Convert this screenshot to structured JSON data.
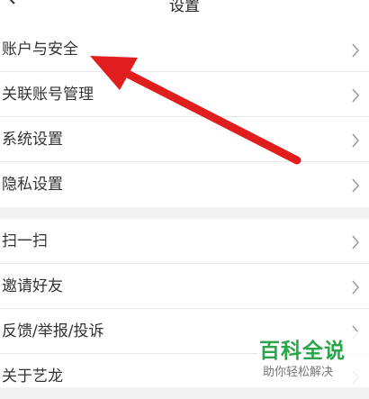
{
  "header": {
    "title": "设置",
    "back_icon": "chevron-left-icon"
  },
  "group1": {
    "items": [
      {
        "label": "账户与安全"
      },
      {
        "label": "关联账号管理"
      },
      {
        "label": "系统设置"
      },
      {
        "label": "隐私设置"
      }
    ]
  },
  "group2": {
    "items": [
      {
        "label": "扫一扫"
      },
      {
        "label": "邀请好友"
      },
      {
        "label": "反馈/举报/投诉"
      },
      {
        "label": "关于艺龙"
      }
    ]
  },
  "colors": {
    "annotation_arrow": "#e01e1e",
    "watermark_green": "#2aa54a"
  },
  "watermark": {
    "title": "百科全说",
    "subtitle": "助你轻松解决"
  }
}
